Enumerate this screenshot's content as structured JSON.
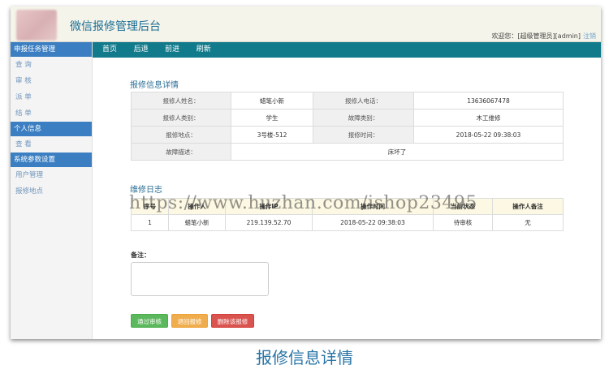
{
  "header": {
    "title": "微信报修管理后台",
    "welcome": "欢迎您：[超级管理员][admin]",
    "logout": "注销"
  },
  "sidebar": {
    "group1": "申报任务管理",
    "group1_items": [
      "查 询",
      "审 核",
      "派 单",
      "结 单"
    ],
    "group2": "个人信息",
    "group2_items": [
      "查 看"
    ],
    "group3": "系统参数设置",
    "group3_items": [
      "用户管理",
      "报修地点"
    ]
  },
  "nav": {
    "items": [
      "首页",
      "后退",
      "前进",
      "刷新"
    ]
  },
  "detail": {
    "title": "报修信息详情",
    "name_label": "报修人姓名：",
    "name_value": "蜡笔小新",
    "phone_label": "报修人电话：",
    "phone_value": "13636067478",
    "category_label": "报修人类别：",
    "category_value": "学生",
    "fault_type_label": "故障类别：",
    "fault_type_value": "木工维修",
    "location_label": "报修地点：",
    "location_value": "3号楼-512",
    "time_label": "报修时间：",
    "time_value": "2018-05-22 09:38:03",
    "desc_label": "故障描述：",
    "desc_value": "床坏了"
  },
  "log": {
    "title": "维修日志",
    "headers": [
      "序号",
      "操作人",
      "操作IP",
      "操作时间",
      "当前状态",
      "操作人备注"
    ],
    "rows": [
      [
        "1",
        "蜡笔小新",
        "219.139.52.70",
        "2018-05-22 09:38:03",
        "待审核",
        "无"
      ]
    ]
  },
  "note": {
    "label": "备注："
  },
  "buttons": {
    "approve": "通过审核",
    "reject": "退回报修",
    "delete": "删除该报修"
  },
  "watermark": "https://www.huzhan.com/ishop23495",
  "caption": "报修信息详情"
}
